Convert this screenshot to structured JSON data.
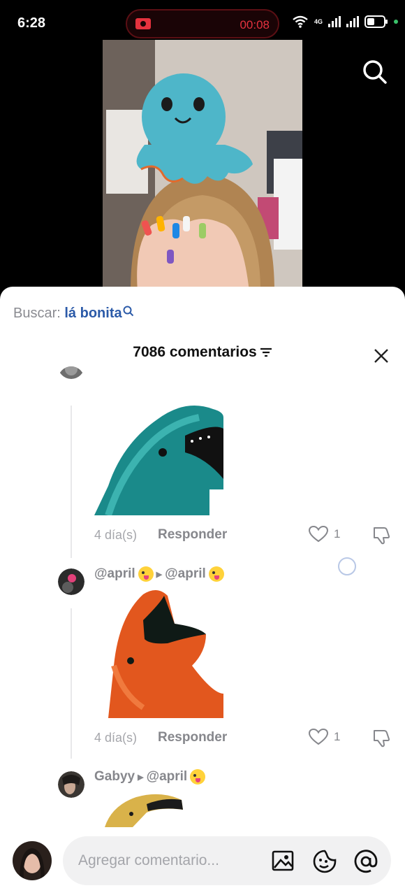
{
  "status_bar": {
    "time": "6:28",
    "recording_timer": "00:08",
    "network_label": "4G",
    "icons": [
      "screen-record-icon",
      "wifi-icon",
      "signal-icon",
      "battery-icon"
    ]
  },
  "video": {
    "icons": [
      "search-icon"
    ]
  },
  "comments_sheet": {
    "search_suggestion": {
      "prefix": "Buscar:",
      "query": "lá bonita"
    },
    "header": {
      "title": "7086 comentarios",
      "icons": [
        "sort-icon",
        "close-icon"
      ]
    },
    "comments": [
      {
        "username": "",
        "reply_to": "",
        "sticker": "teal-dolphin-sticker",
        "age": "4 día(s)",
        "reply_label": "Responder",
        "likes": "1"
      },
      {
        "username": "@april",
        "reply_to": "@april",
        "sticker": "orange-dolphin-sticker",
        "age": "4 día(s)",
        "reply_label": "Responder",
        "likes": "1"
      },
      {
        "username": "Gabyy",
        "reply_to": "@april",
        "sticker": "yellow-dolphin-sticker"
      }
    ]
  },
  "composer": {
    "placeholder": "Agregar comentario...",
    "icons": [
      "image-icon",
      "emoji-icon",
      "mention-icon"
    ]
  },
  "colors": {
    "accent_link": "#2b5aa8",
    "recording_red": "#e5323e",
    "muted_text": "#86878c"
  }
}
